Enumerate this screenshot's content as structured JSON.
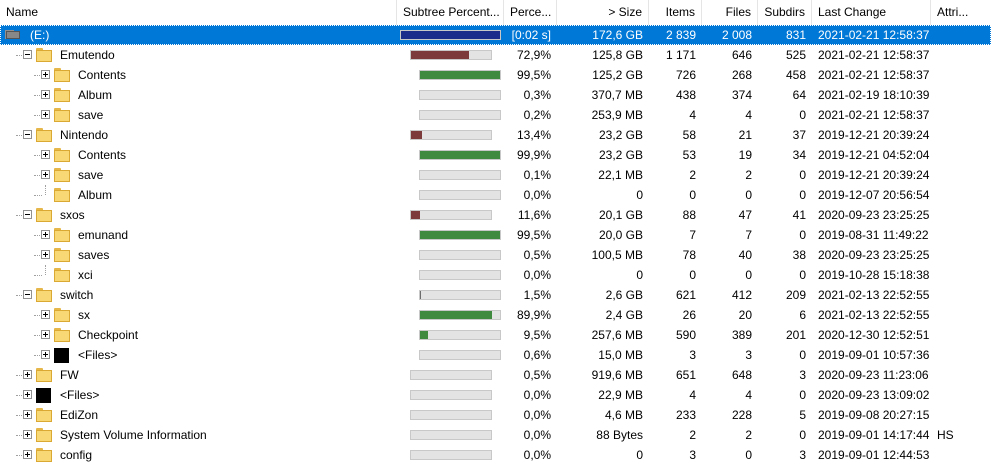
{
  "columns": {
    "name": "Name",
    "subtree": "Subtree Percent...",
    "percent": "Perce...",
    "size": "> Size",
    "items": "Items",
    "files": "Files",
    "subdirs": "Subdirs",
    "last_change": "Last Change",
    "attributes": "Attri..."
  },
  "colors": {
    "selection": "#0078d7",
    "bar_root": "#1c2c8a",
    "bar_level1": "#7d3a3a",
    "bar_level2": "#3f8a3f",
    "bar_level3": "#6c6c6c"
  },
  "rows": [
    {
      "name": "(E:)",
      "icon": "drive-icon",
      "level": 0,
      "expander": "minus",
      "selected": true,
      "bar_fraction": 1.0,
      "bar_level": 0,
      "percent": "[0:02 s]",
      "size": "172,6 GB",
      "items": "2 839",
      "files": "2 008",
      "subdirs": "831",
      "last_change": "2021-02-21  12:58:37",
      "attributes": ""
    },
    {
      "name": "Emutendo",
      "icon": "folder-icon",
      "level": 1,
      "expander": "minus",
      "bar_fraction": 0.729,
      "bar_level": 1,
      "percent": "72,9%",
      "size": "125,8 GB",
      "items": "1 171",
      "files": "646",
      "subdirs": "525",
      "last_change": "2021-02-21  12:58:37",
      "attributes": ""
    },
    {
      "name": "Contents",
      "icon": "folder-icon",
      "level": 2,
      "expander": "plus",
      "bar_fraction": 0.995,
      "bar_level": 2,
      "percent": "99,5%",
      "size": "125,2 GB",
      "items": "726",
      "files": "268",
      "subdirs": "458",
      "last_change": "2021-02-21  12:58:37",
      "attributes": ""
    },
    {
      "name": "Album",
      "icon": "folder-icon",
      "level": 2,
      "expander": "plus",
      "bar_fraction": 0.003,
      "bar_level": 2,
      "percent": "0,3%",
      "size": "370,7 MB",
      "items": "438",
      "files": "374",
      "subdirs": "64",
      "last_change": "2021-02-19  18:10:39",
      "attributes": ""
    },
    {
      "name": "save",
      "icon": "folder-icon",
      "level": 2,
      "expander": "plus",
      "bar_fraction": 0.002,
      "bar_level": 2,
      "percent": "0,2%",
      "size": "253,9 MB",
      "items": "4",
      "files": "4",
      "subdirs": "0",
      "last_change": "2021-02-21  12:58:37",
      "attributes": ""
    },
    {
      "name": "Nintendo",
      "icon": "folder-icon",
      "level": 1,
      "expander": "minus",
      "bar_fraction": 0.134,
      "bar_level": 1,
      "percent": "13,4%",
      "size": "23,2 GB",
      "items": "58",
      "files": "21",
      "subdirs": "37",
      "last_change": "2019-12-21  20:39:24",
      "attributes": ""
    },
    {
      "name": "Contents",
      "icon": "folder-icon",
      "level": 2,
      "expander": "plus",
      "bar_fraction": 0.999,
      "bar_level": 2,
      "percent": "99,9%",
      "size": "23,2 GB",
      "items": "53",
      "files": "19",
      "subdirs": "34",
      "last_change": "2019-12-21  04:52:04",
      "attributes": ""
    },
    {
      "name": "save",
      "icon": "folder-icon",
      "level": 2,
      "expander": "plus",
      "bar_fraction": 0.001,
      "bar_level": 2,
      "percent": "0,1%",
      "size": "22,1 MB",
      "items": "2",
      "files": "2",
      "subdirs": "0",
      "last_change": "2019-12-21  20:39:24",
      "attributes": ""
    },
    {
      "name": "Album",
      "icon": "folder-icon",
      "level": 2,
      "expander": "none",
      "bar_fraction": 0.0,
      "bar_level": 2,
      "percent": "0,0%",
      "size": "0",
      "items": "0",
      "files": "0",
      "subdirs": "0",
      "last_change": "2019-12-07  20:56:54",
      "attributes": ""
    },
    {
      "name": "sxos",
      "icon": "folder-icon",
      "level": 1,
      "expander": "minus",
      "bar_fraction": 0.116,
      "bar_level": 1,
      "percent": "11,6%",
      "size": "20,1 GB",
      "items": "88",
      "files": "47",
      "subdirs": "41",
      "last_change": "2020-09-23  23:25:25",
      "attributes": ""
    },
    {
      "name": "emunand",
      "icon": "folder-icon",
      "level": 2,
      "expander": "plus",
      "bar_fraction": 0.995,
      "bar_level": 2,
      "percent": "99,5%",
      "size": "20,0 GB",
      "items": "7",
      "files": "7",
      "subdirs": "0",
      "last_change": "2019-08-31  11:49:22",
      "attributes": ""
    },
    {
      "name": "saves",
      "icon": "folder-icon",
      "level": 2,
      "expander": "plus",
      "bar_fraction": 0.005,
      "bar_level": 2,
      "percent": "0,5%",
      "size": "100,5 MB",
      "items": "78",
      "files": "40",
      "subdirs": "38",
      "last_change": "2020-09-23  23:25:25",
      "attributes": ""
    },
    {
      "name": "xci",
      "icon": "folder-icon",
      "level": 2,
      "expander": "none",
      "bar_fraction": 0.0,
      "bar_level": 2,
      "percent": "0,0%",
      "size": "0",
      "items": "0",
      "files": "0",
      "subdirs": "0",
      "last_change": "2019-10-28  15:18:38",
      "attributes": ""
    },
    {
      "name": "switch",
      "icon": "folder-icon",
      "level": 1,
      "expander": "minus",
      "bar_fraction": 0.015,
      "bar_level": 3,
      "percent": "1,5%",
      "size": "2,6 GB",
      "items": "621",
      "files": "412",
      "subdirs": "209",
      "last_change": "2021-02-13  22:52:55",
      "attributes": ""
    },
    {
      "name": "sx",
      "icon": "folder-icon",
      "level": 2,
      "expander": "plus",
      "bar_fraction": 0.899,
      "bar_level": 2,
      "percent": "89,9%",
      "size": "2,4 GB",
      "items": "26",
      "files": "20",
      "subdirs": "6",
      "last_change": "2021-02-13  22:52:55",
      "attributes": ""
    },
    {
      "name": "Checkpoint",
      "icon": "folder-icon",
      "level": 2,
      "expander": "plus",
      "bar_fraction": 0.095,
      "bar_level": 2,
      "percent": "9,5%",
      "size": "257,6 MB",
      "items": "590",
      "files": "389",
      "subdirs": "201",
      "last_change": "2020-12-30  12:52:51",
      "attributes": ""
    },
    {
      "name": "<Files>",
      "icon": "files-icon",
      "level": 2,
      "expander": "plus",
      "bar_fraction": 0.006,
      "bar_level": 2,
      "percent": "0,6%",
      "size": "15,0 MB",
      "items": "3",
      "files": "3",
      "subdirs": "0",
      "last_change": "2019-09-01  10:57:36",
      "attributes": ""
    },
    {
      "name": "FW",
      "icon": "folder-icon",
      "level": 1,
      "expander": "plus",
      "bar_fraction": 0.005,
      "bar_level": 1,
      "percent": "0,5%",
      "size": "919,6 MB",
      "items": "651",
      "files": "648",
      "subdirs": "3",
      "last_change": "2020-09-23  11:23:06",
      "attributes": ""
    },
    {
      "name": "<Files>",
      "icon": "files-icon",
      "level": 1,
      "expander": "plus",
      "bar_fraction": 0.0,
      "bar_level": 1,
      "percent": "0,0%",
      "size": "22,9 MB",
      "items": "4",
      "files": "4",
      "subdirs": "0",
      "last_change": "2020-09-23  13:09:02",
      "attributes": ""
    },
    {
      "name": "EdiZon",
      "icon": "folder-icon",
      "level": 1,
      "expander": "plus",
      "bar_fraction": 0.0,
      "bar_level": 1,
      "percent": "0,0%",
      "size": "4,6 MB",
      "items": "233",
      "files": "228",
      "subdirs": "5",
      "last_change": "2019-09-08  20:27:15",
      "attributes": ""
    },
    {
      "name": "System Volume Information",
      "icon": "folder-icon",
      "level": 1,
      "expander": "plus",
      "bar_fraction": 0.0,
      "bar_level": 1,
      "percent": "0,0%",
      "size": "88 Bytes",
      "items": "2",
      "files": "2",
      "subdirs": "0",
      "last_change": "2019-09-01  14:17:44",
      "attributes": "HS"
    },
    {
      "name": "config",
      "icon": "folder-icon",
      "level": 1,
      "expander": "plus",
      "bar_fraction": 0.0,
      "bar_level": 1,
      "percent": "0,0%",
      "size": "0",
      "items": "3",
      "files": "0",
      "subdirs": "3",
      "last_change": "2019-09-01  12:44:53",
      "attributes": ""
    }
  ]
}
